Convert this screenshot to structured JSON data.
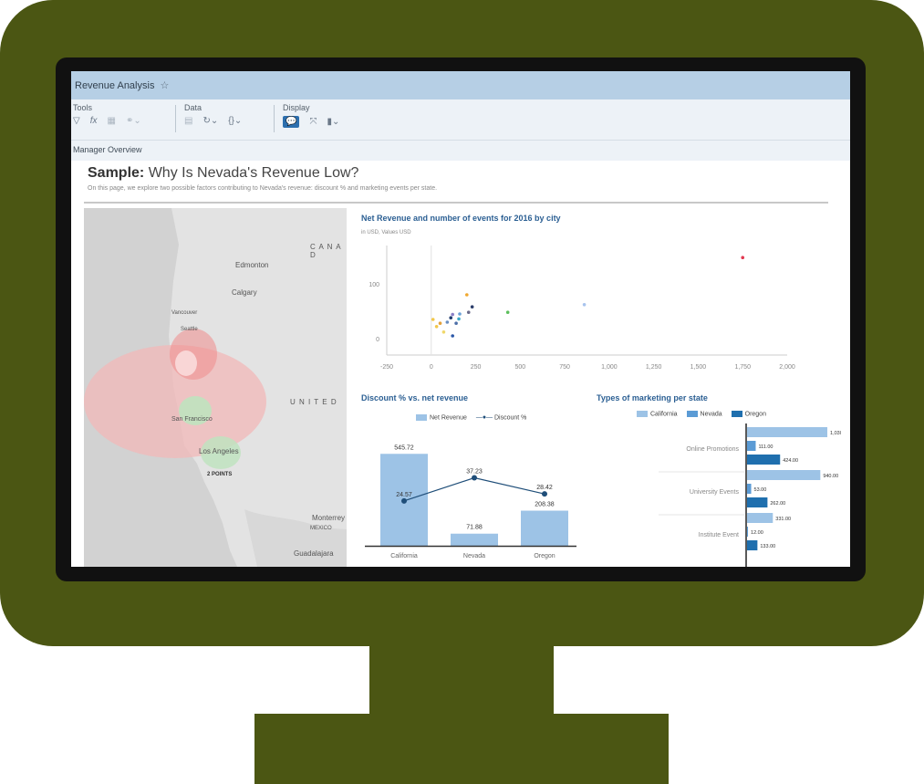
{
  "app": {
    "title": "Revenue Analysis"
  },
  "toolbar": {
    "tools_label": "Tools",
    "data_label": "Data",
    "display_label": "Display"
  },
  "page_tab": "Manager Overview",
  "story": {
    "title_bold": "Sample:",
    "title_rest": " Why Is Nevada's Revenue Low?",
    "subtitle": "On this page, we explore two possible factors contributing to Nevada's revenue: discount % and marketing events per state."
  },
  "map": {
    "labels": {
      "canada": "C A N A D",
      "edmonton": "Edmonton",
      "calgary": "Calgary",
      "vancouver": "Vancouver",
      "seattle": "Seattle",
      "united": "U N I T E D",
      "san_francisco": "San Francisco",
      "los_angeles": "Los Angeles",
      "points": "2 POINTS",
      "monterrey": "Monterrey",
      "mexico": "MEXICO",
      "guadalajara": "Guadalajara"
    }
  },
  "chart_data": [
    {
      "type": "scatter",
      "title": "Net Revenue and number of events for 2016 by city",
      "subtitle": "in USD, Values USD",
      "x_ticks": [
        "-250",
        "0",
        "250",
        "500",
        "750",
        "1,000",
        "1,250",
        "1,500",
        "1,750",
        "2,000"
      ],
      "y_ticks": [
        "0",
        "100"
      ],
      "xlim": [
        -250,
        2000
      ],
      "ylim": [
        -30,
        170
      ],
      "points": [
        {
          "x": 10,
          "y": 35,
          "color": "#f2c74a"
        },
        {
          "x": 30,
          "y": 22,
          "color": "#f2c74a"
        },
        {
          "x": 50,
          "y": 28,
          "color": "#e3a03a"
        },
        {
          "x": 70,
          "y": 12,
          "color": "#f0d86a"
        },
        {
          "x": 90,
          "y": 30,
          "color": "#6a8fc2"
        },
        {
          "x": 110,
          "y": 38,
          "color": "#1f3b6e"
        },
        {
          "x": 120,
          "y": 44,
          "color": "#8b7fc7"
        },
        {
          "x": 140,
          "y": 28,
          "color": "#4d6fa8"
        },
        {
          "x": 155,
          "y": 36,
          "color": "#3ca8c8"
        },
        {
          "x": 160,
          "y": 45,
          "color": "#6aa0d6"
        },
        {
          "x": 120,
          "y": 5,
          "color": "#2b58a8"
        },
        {
          "x": 200,
          "y": 80,
          "color": "#f0a830"
        },
        {
          "x": 210,
          "y": 48,
          "color": "#6a6a8a"
        },
        {
          "x": 230,
          "y": 58,
          "color": "#2c3e6b"
        },
        {
          "x": 430,
          "y": 48,
          "color": "#5cbf5c"
        },
        {
          "x": 860,
          "y": 62,
          "color": "#a8c4ee"
        },
        {
          "x": 1750,
          "y": 148,
          "color": "#e23a52"
        }
      ]
    },
    {
      "type": "bar",
      "title": "Discount % vs. net revenue",
      "categories": [
        "California",
        "Nevada",
        "Oregon"
      ],
      "series": [
        {
          "name": "Net Revenue",
          "values": [
            545.72,
            71.88,
            208.38
          ],
          "labels": [
            "545.72",
            "71.88",
            "208.38"
          ],
          "color": "#9dc3e6"
        },
        {
          "name": "Discount %",
          "values": [
            24.57,
            37.23,
            28.42
          ],
          "labels": [
            "24.57",
            "37.23",
            "28.42"
          ],
          "color": "#1f4e79"
        }
      ],
      "ylim_bar": [
        0,
        650
      ],
      "ylim_line": [
        0,
        60
      ]
    },
    {
      "type": "bar",
      "orientation": "horizontal",
      "title": "Types of marketing per state",
      "categories": [
        "Online Promotions",
        "University Events",
        "Institute Event"
      ],
      "series": [
        {
          "name": "California",
          "values": [
            1030,
            940,
            331
          ],
          "labels": [
            "1,030.00",
            "940.00",
            "331.00"
          ],
          "color": "#9dc3e6"
        },
        {
          "name": "Nevada",
          "values": [
            111,
            53,
            12
          ],
          "labels": [
            "111.00",
            "53.00",
            "12.00"
          ],
          "color": "#5b9bd5"
        },
        {
          "name": "Oregon",
          "values": [
            424,
            262,
            133
          ],
          "labels": [
            "424.00",
            "262.00",
            "133.00"
          ],
          "color": "#1f6fae"
        }
      ],
      "xlim": [
        0,
        1100
      ]
    }
  ]
}
